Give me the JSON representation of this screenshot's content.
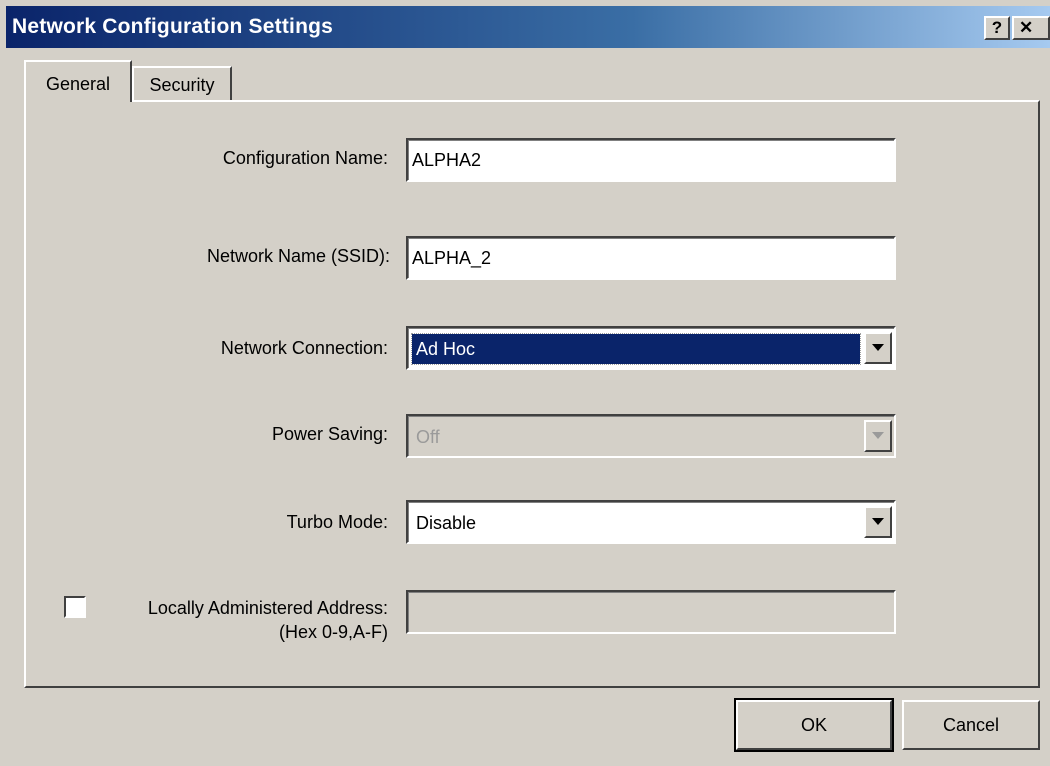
{
  "window": {
    "title": "Network Configuration Settings",
    "help_glyph": "?",
    "close_glyph": "✕"
  },
  "tabs": [
    {
      "label": "General",
      "selected": true
    },
    {
      "label": "Security",
      "selected": false
    }
  ],
  "form": {
    "config_name": {
      "label": "Configuration Name:",
      "value": "ALPHA2"
    },
    "ssid": {
      "label": "Network Name (SSID):",
      "value": "ALPHA_2"
    },
    "connection": {
      "label": "Network Connection:",
      "value": "Ad Hoc"
    },
    "power_saving": {
      "label": "Power Saving:",
      "value": "Off",
      "disabled": true
    },
    "turbo_mode": {
      "label": "Turbo Mode:",
      "value": "Disable"
    },
    "laa": {
      "label_line1": "Locally Administered Address:",
      "label_line2": "(Hex 0-9,A-F)",
      "checked": false,
      "value": ""
    }
  },
  "buttons": {
    "ok": "OK",
    "cancel": "Cancel"
  },
  "colors": {
    "titlebar_start": "#0a246a",
    "titlebar_end": "#a6caf0",
    "face": "#d4d0c8",
    "selection": "#0a246a"
  }
}
